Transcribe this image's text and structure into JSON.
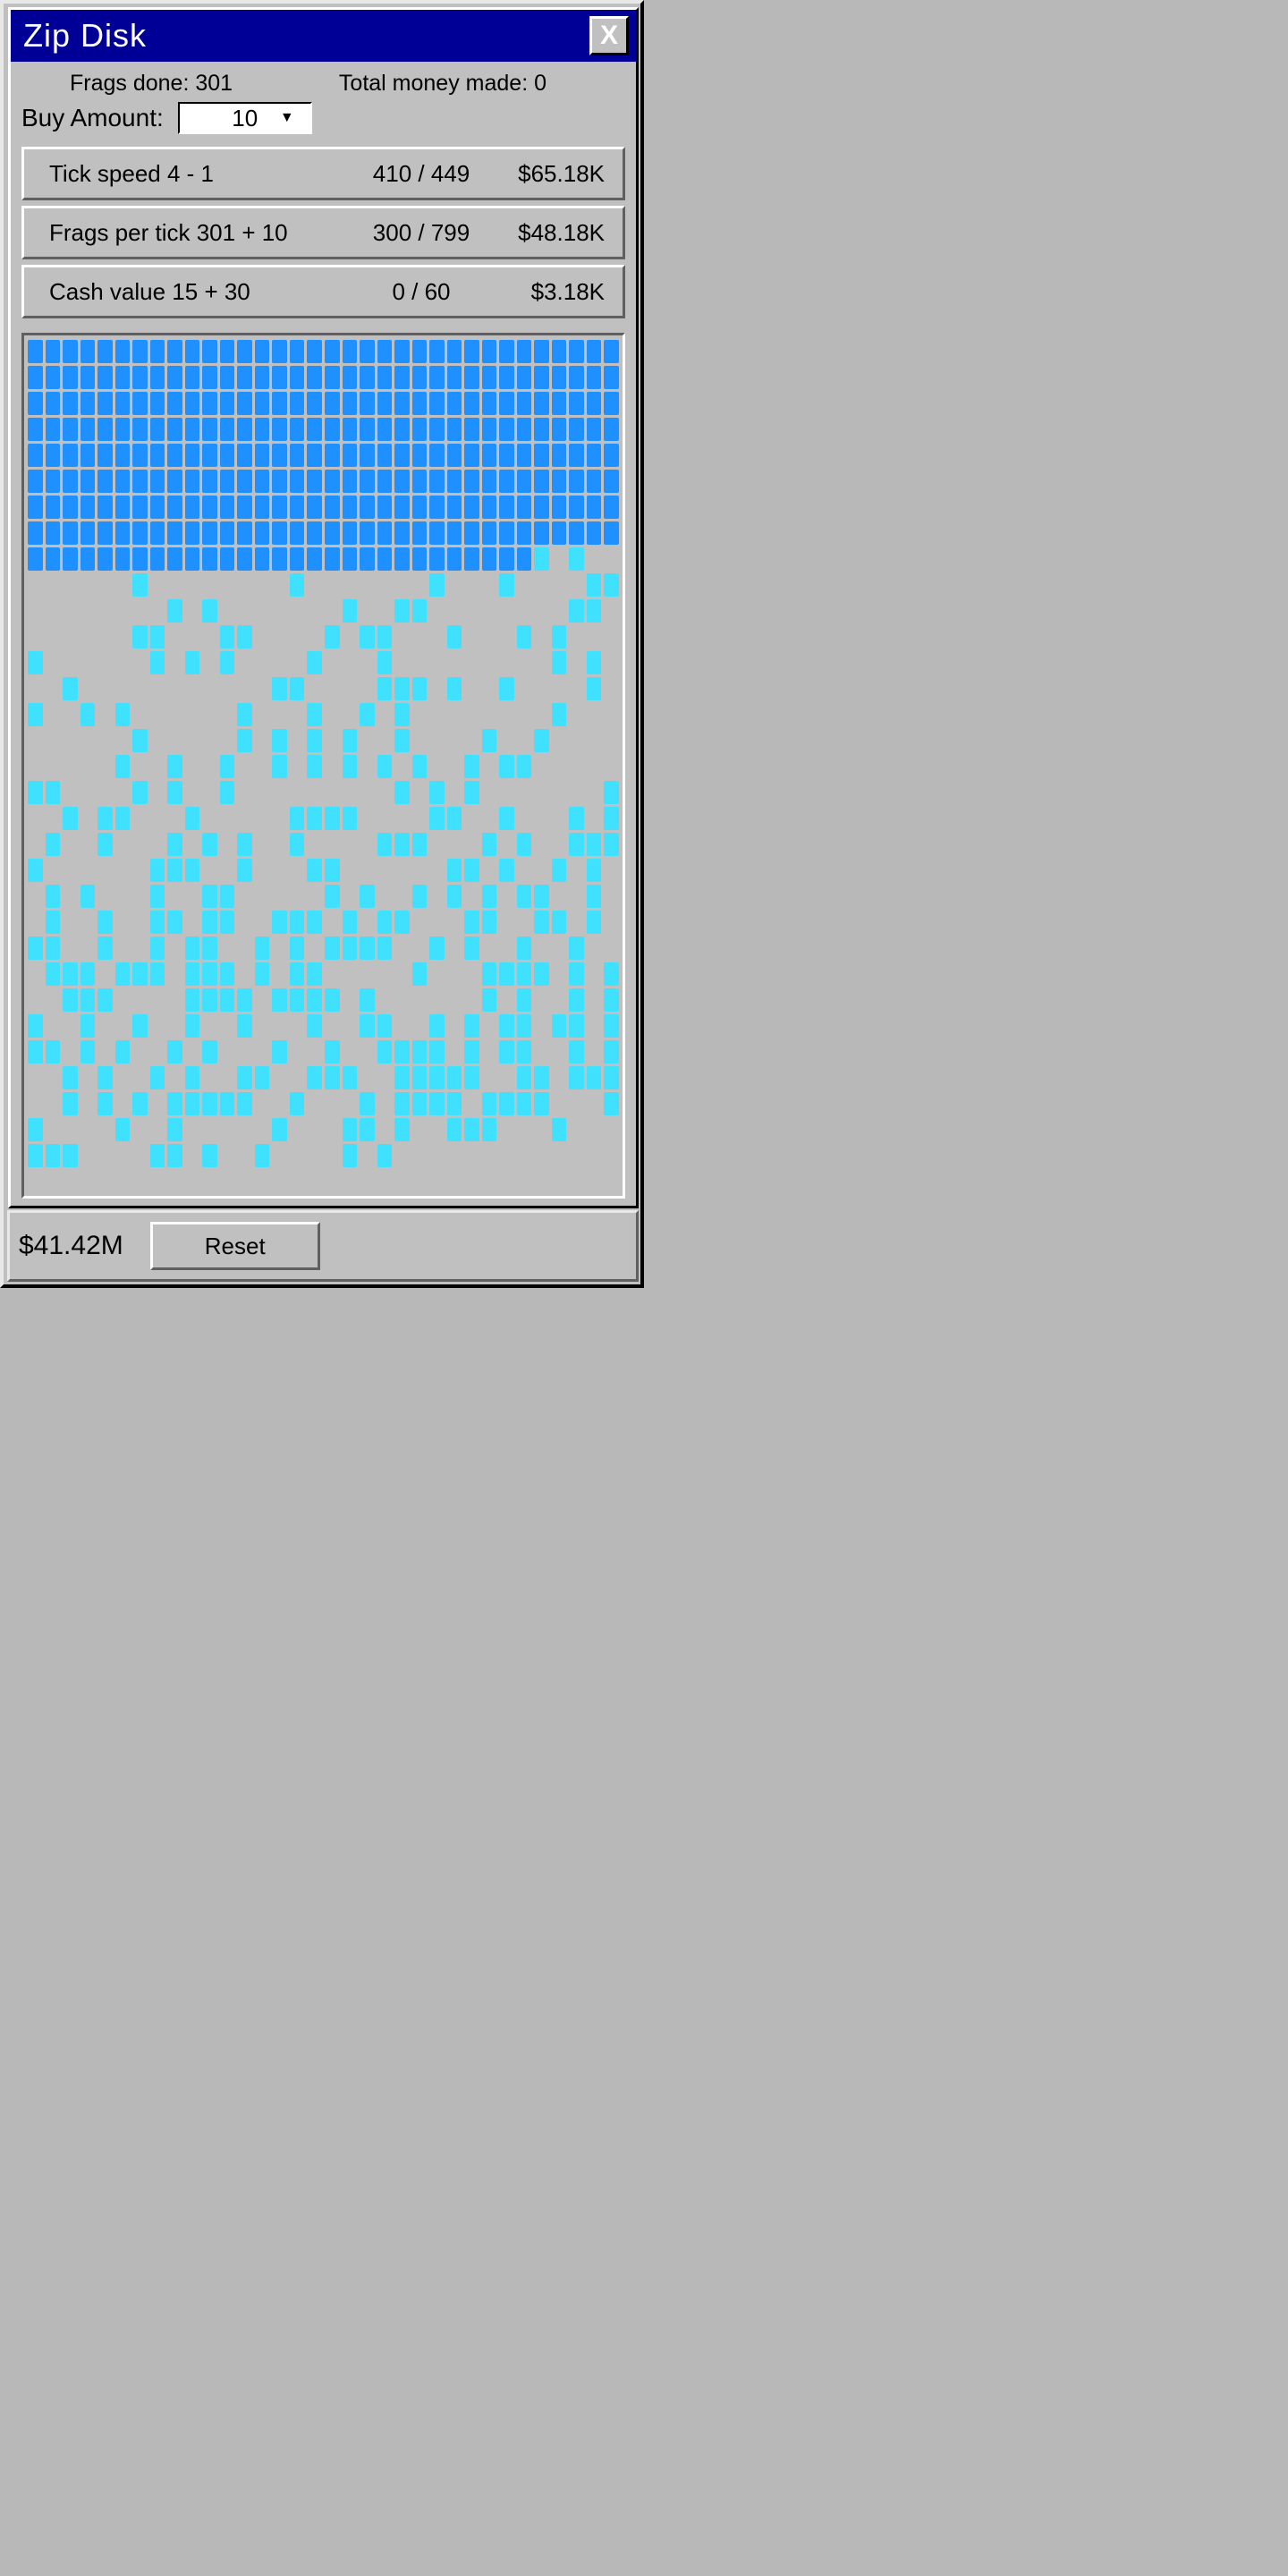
{
  "window": {
    "title": "Zip Disk",
    "close_label": "X"
  },
  "stats": {
    "frags_done_label": "Frags done:",
    "frags_done_value": "301",
    "total_money_label": "Total money made:",
    "total_money_value": "0"
  },
  "buy": {
    "label": "Buy Amount:",
    "selected": "10"
  },
  "upgrades": [
    {
      "name": "Tick speed 4 - 1",
      "progress": "410 / 449",
      "cost": "$65.18K"
    },
    {
      "name": "Frags per tick 301 + 10",
      "progress": "300 / 799",
      "cost": "$48.18K"
    },
    {
      "name": "Cash value 15 + 30",
      "progress": "0 / 60",
      "cost": "$3.18K"
    }
  ],
  "grid": {
    "cols": 34,
    "done_count": 301,
    "pending_pattern": "101000000001000000001000000010001000011000000001010000000100110000000011000000011000110000101100010001010001000000101010000100010000000001010001000000000001100001110100100001010010100000010001001010000000010000000001000001010101001000010010000000001001001001010101010010110000011000010100100000000010101000000010010110001000001111000011001000101010010001010100100001110001010011110000001110010001100000011010010100101000100110000010100101010110010010010011011001110101100011001101011001001011001010111100101001001000111011101110101100000100011110101001110000111101111010000001010010110010010010010001001100101011011011101010010100010010011110101100101001010010100110011100111110011011100101010111110010001011110111100011000010010000010001101001110001000111000011010010000101"
  },
  "footer": {
    "money": "$41.42M",
    "reset_label": "Reset"
  }
}
